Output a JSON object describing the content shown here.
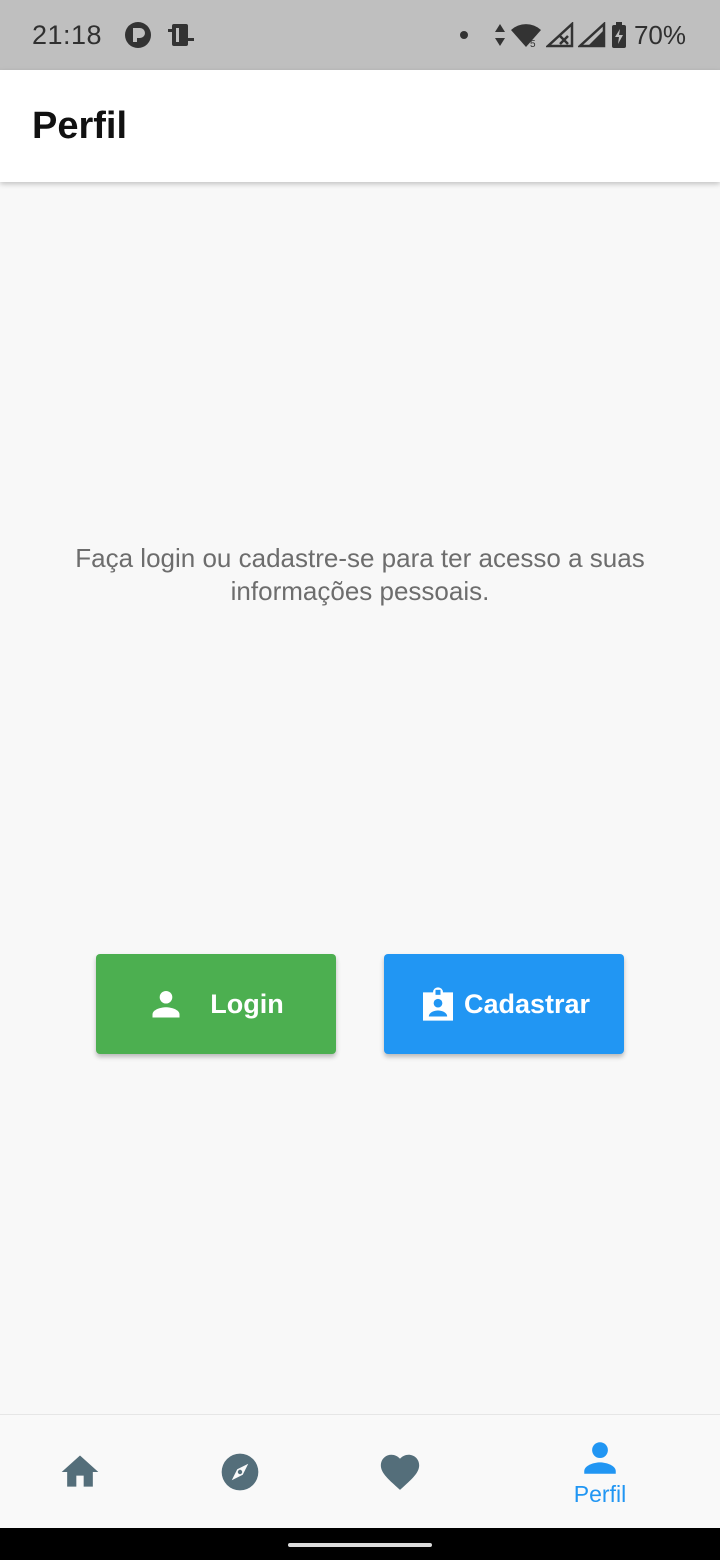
{
  "status_bar": {
    "time": "21:18",
    "battery": "70%",
    "icons": [
      "notification-app-icon",
      "sim-icon",
      "dot-icon",
      "data-arrows-icon",
      "wifi-icon",
      "signal-off-icon",
      "signal-icon",
      "battery-charging-icon"
    ]
  },
  "app_bar": {
    "title": "Perfil"
  },
  "main": {
    "message": "Faça login ou cadastre-se para ter acesso a suas informações pessoais.",
    "login_label": "Login",
    "register_label": "Cadastrar",
    "login_icon": "person-icon",
    "register_icon": "badge-icon"
  },
  "bottom_nav": {
    "items": [
      {
        "icon": "home-icon",
        "label": ""
      },
      {
        "icon": "compass-icon",
        "label": ""
      },
      {
        "icon": "heart-icon",
        "label": ""
      },
      {
        "icon": "person-icon",
        "label": "Perfil",
        "active": true
      }
    ]
  },
  "colors": {
    "login": "#4caf50",
    "register": "#2196f3",
    "nav_inactive": "#546e7a",
    "nav_active": "#2196f3"
  }
}
